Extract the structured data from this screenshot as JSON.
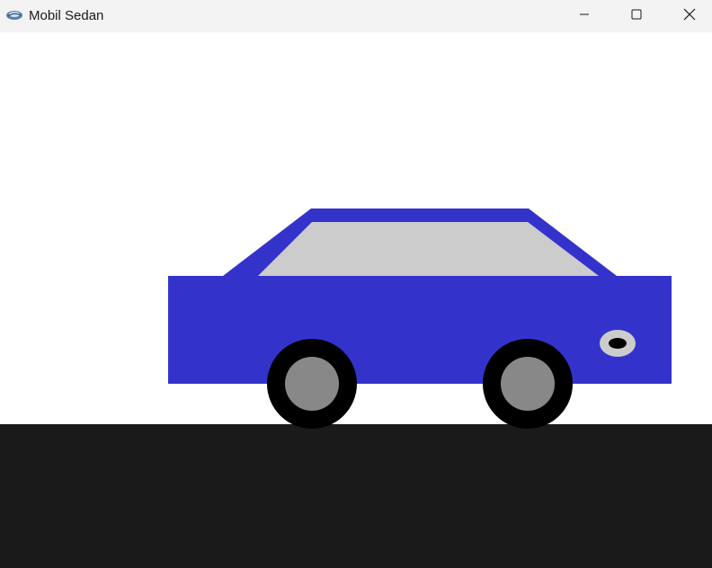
{
  "window": {
    "title": "Mobil Sedan",
    "controls": [
      "minimize",
      "maximize",
      "close"
    ]
  },
  "icons": {
    "app": "app-logo-icon",
    "minimize": "minimize-icon",
    "maximize": "maximize-icon",
    "close": "close-icon"
  },
  "colors": {
    "titlebar_bg": "#f3f3f3",
    "sky": "#ffffff",
    "road": "#1a1a1a",
    "car_body": "#3333cc",
    "window_glass": "#cccccc",
    "tire": "#000000",
    "rim": "#888888",
    "headlight_outer": "#cccccc",
    "headlight_inner": "#000000"
  }
}
